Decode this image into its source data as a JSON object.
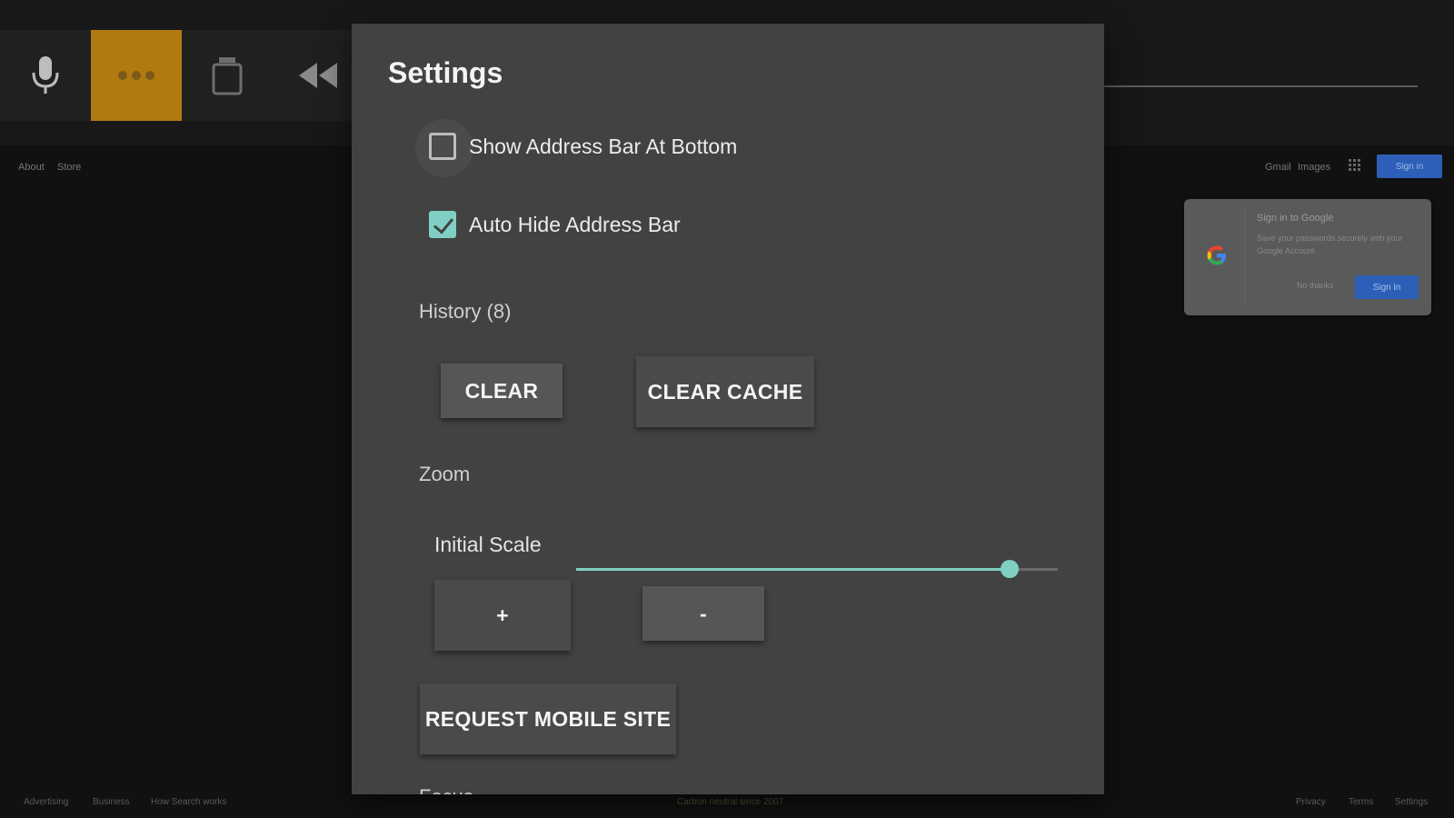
{
  "background_page": {
    "top_links": [
      "About",
      "Store"
    ],
    "right_links": [
      "Gmail",
      "Images"
    ],
    "sign_in_button": "Sign in",
    "google_card": {
      "title": "Sign in to Google",
      "description": "Save your passwords securely with your Google Account",
      "no_thanks": "No thanks",
      "sign_in": "Sign in"
    },
    "footer_left": [
      "Advertising",
      "Business",
      "How Search works"
    ],
    "footer_center": "Carbon neutral since 2007",
    "footer_right": [
      "Privacy",
      "Terms",
      "Settings"
    ]
  },
  "toolbar": {
    "buttons": [
      {
        "name": "microphone-icon",
        "active": false
      },
      {
        "name": "more-icon",
        "active": true
      },
      {
        "name": "tab-icon",
        "active": false
      },
      {
        "name": "rewind-icon",
        "active": false
      }
    ],
    "accent_color": "#b07a10"
  },
  "settings": {
    "title": "Settings",
    "show_address_bar_bottom": {
      "label": "Show Address Bar At Bottom",
      "checked": false
    },
    "auto_hide_address_bar": {
      "label": "Auto Hide Address Bar",
      "checked": true
    },
    "history_label": "History (8)",
    "clear_button": "CLEAR",
    "clear_cache_button": "CLEAR CACHE",
    "zoom_label": "Zoom",
    "initial_scale_label": "Initial Scale",
    "initial_scale_value": 0.9,
    "zoom_in_button": "+",
    "zoom_out_button": "-",
    "request_mobile_button": "REQUEST MOBILE SITE",
    "next_section_label": "Focus",
    "accent_color": "#7fcfc4"
  }
}
